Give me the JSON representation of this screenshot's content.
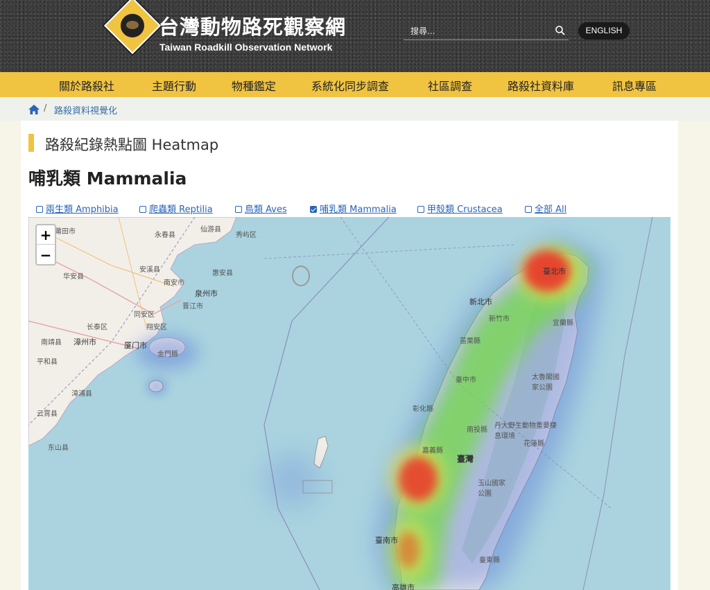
{
  "header": {
    "title": "台灣動物路死觀察網",
    "subtitle": "Taiwan Roadkill Observation Network",
    "search_placeholder": "搜尋...",
    "english_label": "ENGLISH"
  },
  "nav": {
    "items": [
      "關於路殺社",
      "主題行動",
      "物種鑑定",
      "系統化同步調查",
      "社區調查",
      "路殺社資料庫",
      "訊息專區"
    ]
  },
  "breadcrumb": {
    "separator": "/",
    "current": "路殺資料視覺化"
  },
  "main": {
    "heading": "路殺紀錄熱點圖 Heatmap",
    "subheading": "哺乳類 Mammalia",
    "filters": [
      {
        "label": "兩生類 Amphibia",
        "checked": false
      },
      {
        "label": "爬蟲類 Reptilia",
        "checked": false
      },
      {
        "label": "鳥類 Aves",
        "checked": false
      },
      {
        "label": "哺乳類 Mammalia",
        "checked": true
      },
      {
        "label": "甲殼類 Crustacea",
        "checked": false
      },
      {
        "label": "全部 All",
        "checked": false
      }
    ]
  },
  "map": {
    "zoom_in": "+",
    "zoom_out": "−",
    "labels": {
      "putian": "莆田市",
      "yongchun": "永春县",
      "xianyou": "仙游县",
      "huaan": "华安县",
      "anxi": "安溪县",
      "nanan": "南安市",
      "quanzhou": "泉州市",
      "jinjiang": "晋江市",
      "huian": "惠安县",
      "tongan": "同安区",
      "xiangan": "翔安区",
      "changtai": "长泰区",
      "zhangzhou": "漳州市",
      "xiamen": "厦门市",
      "nanjing": "南靖县",
      "pinghe": "平和县",
      "zhangpu": "漳浦县",
      "yunxiao": "云霄县",
      "dongshan": "东山县",
      "kinmen": "金門縣",
      "xiuyu": "秀屿区",
      "taipei": "臺北市",
      "newtaipei": "新北市",
      "yilan": "宜蘭縣",
      "xinzhu": "新竹市",
      "miaoli": "苗栗縣",
      "taichung": "臺中市",
      "taroko": "太魯閣國家公園",
      "changhua": "彰化縣",
      "nantou": "南投縣",
      "danda": "丹大野生動物重要棲息環境",
      "hualien": "花蓮縣",
      "taiwan": "臺灣",
      "yushan": "玉山國家公園",
      "tainan": "臺南市",
      "taitung": "臺東縣",
      "kaohsiung": "高雄市",
      "jiayi": "嘉義縣"
    }
  },
  "colors": {
    "accent": "#f0c341",
    "link": "#2a64b8",
    "heat_high": "#e8342a",
    "heat_mid": "#6fdc3c",
    "heat_low": "#5a78d8",
    "sea": "#aad3df"
  }
}
